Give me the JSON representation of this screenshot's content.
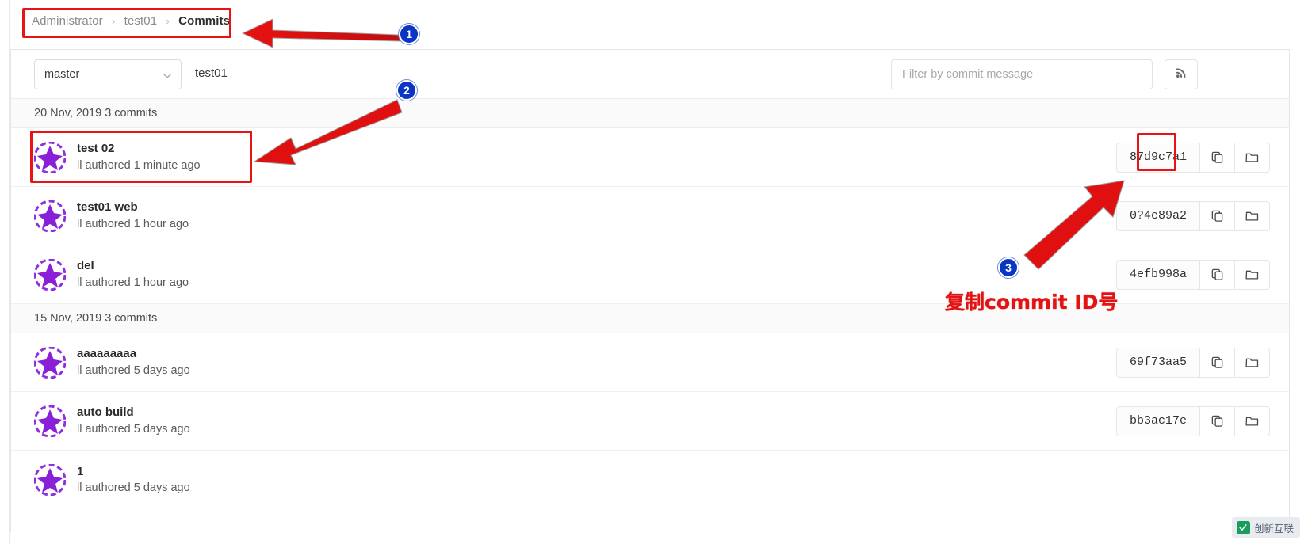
{
  "breadcrumb": {
    "owner": "Administrator",
    "repo": "test01",
    "current": "Commits",
    "separator": "›"
  },
  "toolbar": {
    "branch": "master",
    "branch_caret_icon": "chevron-down-icon",
    "repo_name": "test01",
    "filter_placeholder": "Filter by commit message",
    "filter_value": "",
    "rss_icon": "rss-icon"
  },
  "icons": {
    "copy": "copy-icon",
    "browse_files": "folder-icon"
  },
  "groups": [
    {
      "date_label": "20 Nov, 2019 3 commits",
      "commits": [
        {
          "title": "test 02",
          "meta": "ll authored 1 minute ago",
          "sha": "87d9c7a1"
        },
        {
          "title": "test01 web",
          "meta": "ll authored 1 hour ago",
          "sha": "0?4e89a2"
        },
        {
          "title": "del",
          "meta": "ll authored 1 hour ago",
          "sha": "4efb998a"
        }
      ]
    },
    {
      "date_label": "15 Nov, 2019 3 commits",
      "commits": [
        {
          "title": "aaaaaaaaa",
          "meta": "ll authored 5 days ago",
          "sha": "69f73aa5"
        },
        {
          "title": "auto build",
          "meta": "ll authored 5 days ago",
          "sha": "bb3ac17e"
        },
        {
          "title": "1",
          "meta": "ll authored 5 days ago",
          "sha": ""
        }
      ]
    }
  ],
  "annotations": {
    "badge1": "1",
    "badge2": "2",
    "badge3": "3",
    "note_cn": "复制commit ID号",
    "box_color": "#e81313",
    "badge_color": "#0b36c4"
  },
  "watermark": {
    "text": "创新互联"
  }
}
